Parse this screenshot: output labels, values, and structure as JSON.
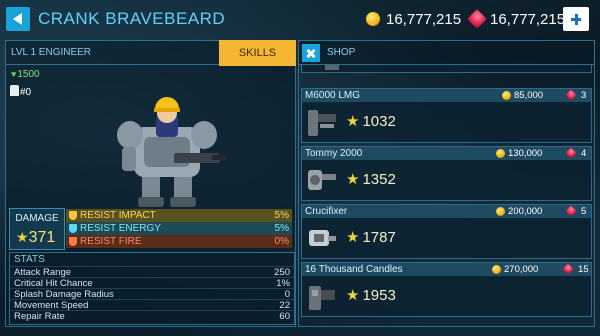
{
  "header": {
    "hero_name": "CRANK BRAVEBEARD",
    "coins": "16,777,215",
    "gems": "16,777,215"
  },
  "hero": {
    "class_label": "LVL 1 ENGINEER",
    "skills_label": "SKILLS",
    "hp": "1500",
    "count": "#0"
  },
  "damage": {
    "label": "DAMAGE",
    "value": "371"
  },
  "resists": [
    {
      "name": "RESIST IMPACT",
      "value": "5%"
    },
    {
      "name": "RESIST ENERGY",
      "value": "5%"
    },
    {
      "name": "RESIST FIRE",
      "value": "0%"
    }
  ],
  "stats": {
    "title": "STATS",
    "rows": [
      {
        "name": "Attack Range",
        "value": "250"
      },
      {
        "name": "Critical Hit Chance",
        "value": "1%"
      },
      {
        "name": "Splash Damage Radius",
        "value": "0"
      },
      {
        "name": "Movement Speed",
        "value": "22"
      },
      {
        "name": "Repair Rate",
        "value": "60"
      }
    ]
  },
  "shop": {
    "label": "SHOP",
    "items": [
      {
        "name": "M6000 LMG",
        "price": "85,000",
        "gems": "3",
        "power": "1032"
      },
      {
        "name": "Tommy 2000",
        "price": "130,000",
        "gems": "4",
        "power": "1352"
      },
      {
        "name": "Crucifixer",
        "price": "200,000",
        "gems": "5",
        "power": "1787"
      },
      {
        "name": "16 Thousand Candles",
        "price": "270,000",
        "gems": "15",
        "power": "1953"
      }
    ]
  },
  "colors": {
    "accent_blue": "#1aa3d9",
    "skills_orange": "#f5b733",
    "resist_impact": "#f6d85c",
    "resist_energy": "#7fe5f2",
    "resist_fire": "#ff8a58"
  }
}
